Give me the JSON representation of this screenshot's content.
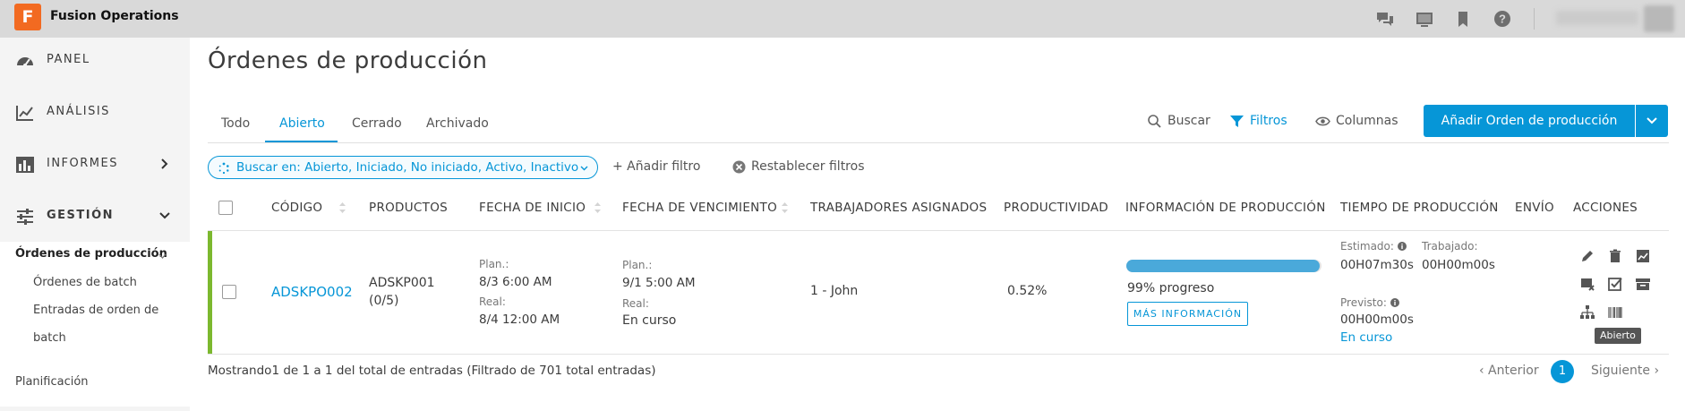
{
  "app": {
    "logo_letter": "F",
    "title": "Fusion Operations"
  },
  "topbar": {
    "icons": [
      "chat-icon",
      "display-icon",
      "bookmark-icon",
      "help-icon"
    ]
  },
  "sidebar": {
    "items": [
      {
        "label": "PANEL",
        "icon": "gauge-icon"
      },
      {
        "label": "ANÁLISIS",
        "icon": "line-chart-icon"
      },
      {
        "label": "INFORMES",
        "icon": "bar-chart-icon"
      },
      {
        "label": "GESTIÓN",
        "icon": "sliders-icon"
      }
    ],
    "active_section": "Órdenes de producción",
    "sub_items": [
      "Órdenes de batch",
      "Entradas de orden de",
      "batch"
    ],
    "bottom_item": "Planificación"
  },
  "main": {
    "title": "Órdenes de producción",
    "tabs": [
      "Todo",
      "Abierto",
      "Cerrado",
      "Archivado"
    ],
    "active_tab": "Abierto",
    "toolbar": {
      "search": "Buscar",
      "filters": "Filtros",
      "columns": "Columnas",
      "add_order": "Añadir Orden de producción"
    },
    "filter_bar": {
      "search_chip": "Buscar en: Abierto, Iniciado, No iniciado, Activo, Inactivo",
      "add_filter": "+ Añadir filtro",
      "reset_filters": "Restablecer filtros"
    },
    "table": {
      "headers": [
        "CÓDIGO",
        "PRODUCTOS",
        "FECHA DE INICIO",
        "FECHA DE VENCIMIENTO",
        "TRABAJADORES ASIGNADOS",
        "PRODUCTIVIDAD",
        "INFORMACIÓN DE PRODUCCIÓN",
        "TIEMPO DE PRODUCCIÓN",
        "ENVÍO",
        "ACCIONES"
      ],
      "row": {
        "code": "ADSKPO002",
        "product": "ADSKP001",
        "product_count": "(0/5)",
        "start_plan_label": "Plan.:",
        "start_plan": "8/3   6:00 AM",
        "start_real_label": "Real:",
        "start_real": "8/4   12:00 AM",
        "due_plan_label": "Plan.:",
        "due_plan": "9/1   5:00 AM",
        "due_real_label": "Real:",
        "due_real": "En curso",
        "workers": "1 - John",
        "productivity": "0.52%",
        "progress_value": 0.99,
        "progress_text": "99% progreso",
        "more_info": "MÁS INFORMACIÓN",
        "estimated_label": "Estimado:",
        "estimated": "00H07m30s",
        "worked_label": "Trabajado:",
        "worked": "00H00m00s",
        "forecast_label": "Previsto:",
        "forecast": "00H00m00s",
        "forecast_status": "En curso",
        "tooltip": "Abierto"
      }
    },
    "footer": {
      "info": "Mostrando1 de 1 a 1 del total de entradas (Filtrado de 701 total entradas)",
      "prev": "‹ Anterior",
      "page": "1",
      "next": "Siguiente ›"
    }
  },
  "colors": {
    "accent": "#0696d7",
    "row_status": "#7cb82f",
    "brand": "#f26a21"
  }
}
